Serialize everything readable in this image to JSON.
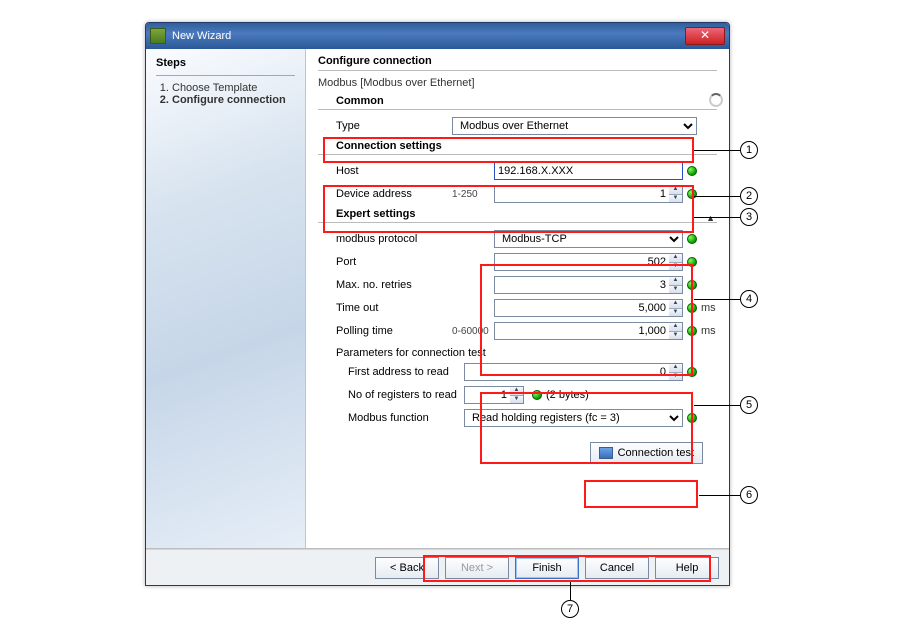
{
  "window": {
    "title": "New Wizard"
  },
  "sidebar": {
    "heading": "Steps",
    "items": [
      {
        "label": "Choose Template",
        "active": false
      },
      {
        "label": "Configure connection",
        "active": true
      }
    ]
  },
  "main": {
    "heading": "Configure connection",
    "subtitle": "Modbus [Modbus over Ethernet]",
    "common": {
      "heading": "Common",
      "type_label": "Type",
      "type_value": "Modbus over Ethernet"
    },
    "conn": {
      "heading": "Connection settings",
      "host_label": "Host",
      "host_value": "192.168.X.XXX",
      "devaddr_label": "Device address",
      "devaddr_hint": "1-250",
      "devaddr_value": "1"
    },
    "expert": {
      "heading": "Expert settings",
      "protocol_label": "modbus protocol",
      "protocol_value": "Modbus-TCP",
      "port_label": "Port",
      "port_value": "502",
      "retries_label": "Max. no. retries",
      "retries_value": "3",
      "timeout_label": "Time out",
      "timeout_value": "5,000",
      "timeout_unit": "ms",
      "polling_label": "Polling time",
      "polling_hint": "0-60000",
      "polling_value": "1,000",
      "polling_unit": "ms",
      "param_heading": "Parameters for connection test",
      "firstaddr_label": "First address to read",
      "firstaddr_value": "0",
      "nregs_label": "No of registers to read",
      "nregs_value": "1",
      "nregs_note": "(2 bytes)",
      "func_label": "Modbus function",
      "func_value": "Read holding registers (fc = 3)",
      "test_button": "Connection test"
    }
  },
  "footer": {
    "back": "< Back",
    "next": "Next >",
    "finish": "Finish",
    "cancel": "Cancel",
    "help": "Help"
  },
  "callouts": [
    "1",
    "2",
    "3",
    "4",
    "5",
    "6",
    "7"
  ]
}
